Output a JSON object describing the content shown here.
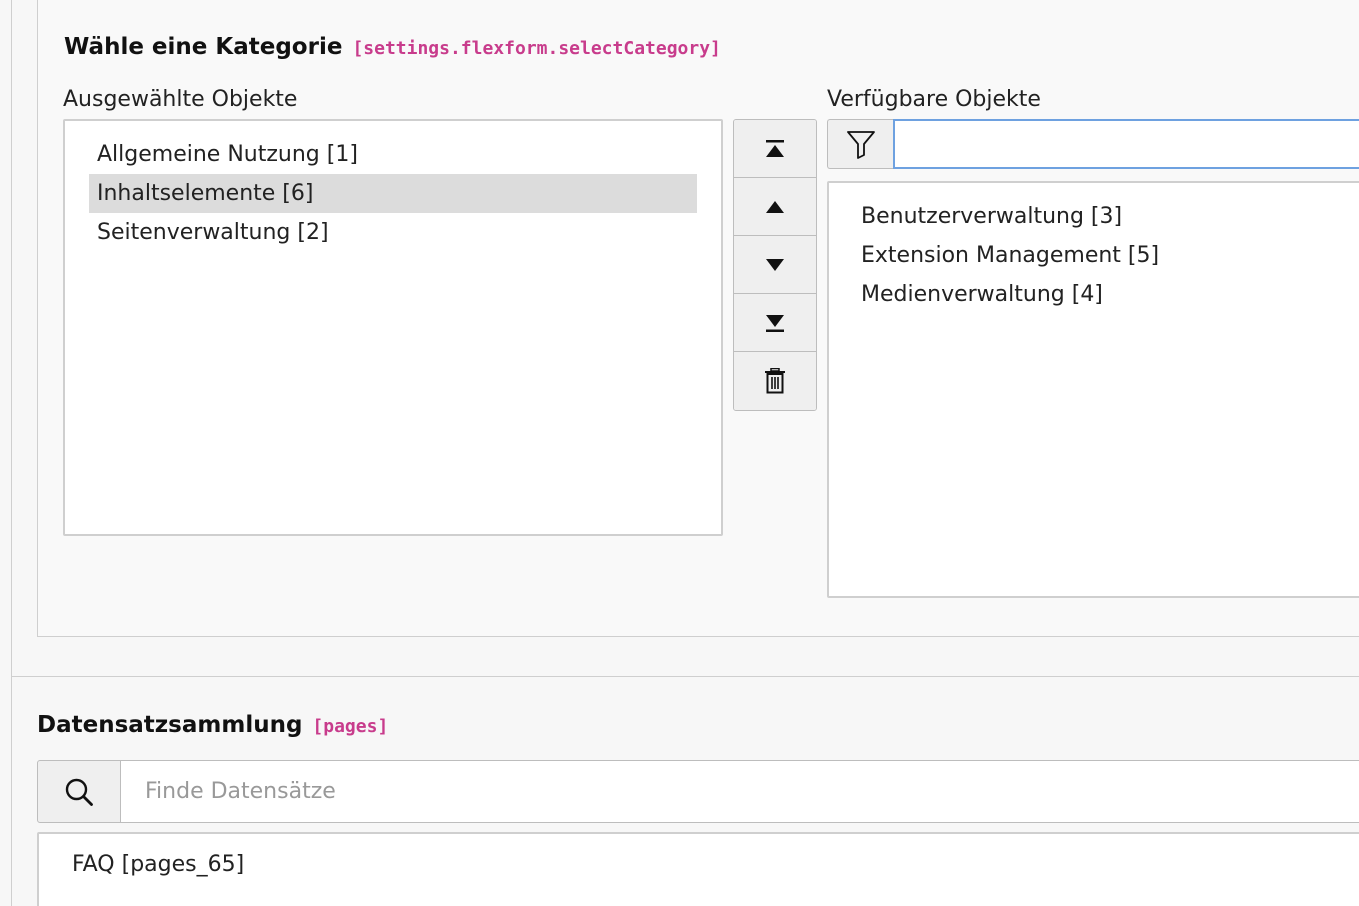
{
  "category_field": {
    "title": "Wähle eine Kategorie",
    "code": "[settings.flexform.selectCategory]",
    "selected_label": "Ausgewählte Objekte",
    "available_label": "Verfügbare Objekte",
    "selected_items": [
      {
        "label": "Allgemeine Nutzung [1]",
        "selected": false
      },
      {
        "label": "Inhaltselemente [6]",
        "selected": true
      },
      {
        "label": "Seitenverwaltung [2]",
        "selected": false
      }
    ],
    "available_items": [
      {
        "label": "Benutzerverwaltung [3]"
      },
      {
        "label": "Extension Management [5]"
      },
      {
        "label": "Medienverwaltung [4]"
      }
    ],
    "filter_value": "",
    "buttons": [
      "move-to-top",
      "move-up",
      "move-down",
      "move-to-bottom",
      "remove"
    ]
  },
  "record_field": {
    "title": "Datensatzsammlung",
    "code": "[pages]",
    "search_placeholder": "Finde Datensätze",
    "records": [
      {
        "label": "FAQ [pages_65]"
      }
    ]
  }
}
